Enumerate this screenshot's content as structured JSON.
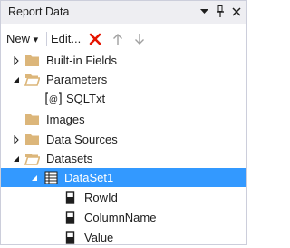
{
  "window": {
    "title": "Report Data"
  },
  "toolbar": {
    "new_label": "New",
    "new_dropdown_glyph": "▾",
    "edit_label": "Edit..."
  },
  "tree": {
    "items": [
      {
        "label": "Built-in Fields",
        "expanded": false,
        "icon": "folder-icon"
      },
      {
        "label": "Parameters",
        "expanded": true,
        "icon": "folder-open-icon"
      },
      {
        "label": "SQLTxt",
        "icon": "parameter-icon"
      },
      {
        "label": "Images",
        "icon": "folder-icon"
      },
      {
        "label": "Data Sources",
        "expanded": false,
        "icon": "folder-icon"
      },
      {
        "label": "Datasets",
        "expanded": true,
        "icon": "folder-open-icon"
      },
      {
        "label": "DataSet1",
        "expanded": true,
        "selected": true,
        "icon": "dataset-icon"
      },
      {
        "label": "RowId",
        "icon": "field-icon"
      },
      {
        "label": "ColumnName",
        "icon": "field-icon"
      },
      {
        "label": "Value",
        "icon": "field-icon"
      }
    ]
  },
  "colors": {
    "selection": "#3399ff",
    "folder": "#dcb67a",
    "delete": "#e51400",
    "disabled_arrow": "#a0a0a0"
  }
}
